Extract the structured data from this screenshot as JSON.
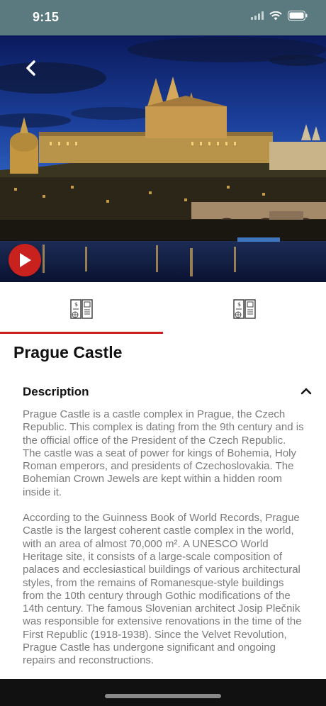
{
  "status": {
    "time": "9:15"
  },
  "hero": {
    "image_alt": "Prague Castle night view over the Vltava river"
  },
  "tabs": [
    {
      "icon": "brochure-icon",
      "active": true
    },
    {
      "icon": "brochure-icon",
      "active": false
    }
  ],
  "place": {
    "title": "Prague Castle"
  },
  "description": {
    "heading": "Description",
    "expanded": true,
    "paragraphs": [
      "Prague Castle is a castle complex in Prague, the Czech Republic. This complex is dating from the 9th century and is the official office of the President of the Czech Republic. The castle was a seat of power for kings of Bohemia, Holy Roman emperors, and presidents of Czechoslovakia. The Bohemian Crown Jewels are kept within a hidden room inside it.",
      "According to the Guinness Book of World Records, Prague Castle is the largest coherent castle complex in the world, with an area of almost 70,000 m². A UNESCO World Heritage site, it consists of a large-scale composition of palaces and ecclesiastical buildings of various architectural styles, from the remains of Romanesque-style buildings from the 10th century through Gothic modifications of the 14th century. The famous Slovenian architect Josip Plečnik was responsible for extensive renovations in the time of the First Republic (1918-1938). Since the Velvet Revolution, Prague Castle has undergone significant and ongoing repairs and reconstructions."
    ]
  },
  "colors": {
    "accent": "#c9211e",
    "status_bar": "#5a7a80",
    "text_muted": "#7a7a7a"
  }
}
